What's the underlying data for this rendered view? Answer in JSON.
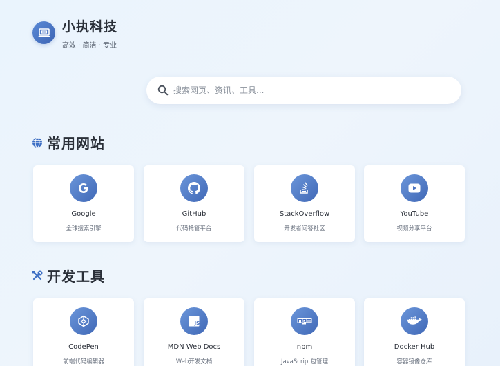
{
  "brand": {
    "title": "小执科技",
    "subtitle": "高效 · 简洁 · 专业"
  },
  "search": {
    "placeholder": "搜索网页、资讯、工具..."
  },
  "sections": [
    {
      "title": "常用网站",
      "icon": "globe-icon",
      "items": [
        {
          "name": "Google",
          "desc": "全球搜索引擎",
          "icon": "google-icon"
        },
        {
          "name": "GitHub",
          "desc": "代码托管平台",
          "icon": "github-icon"
        },
        {
          "name": "StackOverflow",
          "desc": "开发者问答社区",
          "icon": "stackoverflow-icon"
        },
        {
          "name": "YouTube",
          "desc": "视频分享平台",
          "icon": "youtube-icon"
        }
      ]
    },
    {
      "title": "开发工具",
      "icon": "tools-icon",
      "items": [
        {
          "name": "CodePen",
          "desc": "前端代码编辑器",
          "icon": "codepen-icon"
        },
        {
          "name": "MDN Web Docs",
          "desc": "Web开发文档",
          "icon": "js-icon"
        },
        {
          "name": "npm",
          "desc": "JavaScript包管理",
          "icon": "npm-icon"
        },
        {
          "name": "Docker Hub",
          "desc": "容器镜像仓库",
          "icon": "docker-icon"
        }
      ]
    }
  ],
  "colors": {
    "accent": "#4a74c4",
    "background": "#eaf4fd"
  }
}
